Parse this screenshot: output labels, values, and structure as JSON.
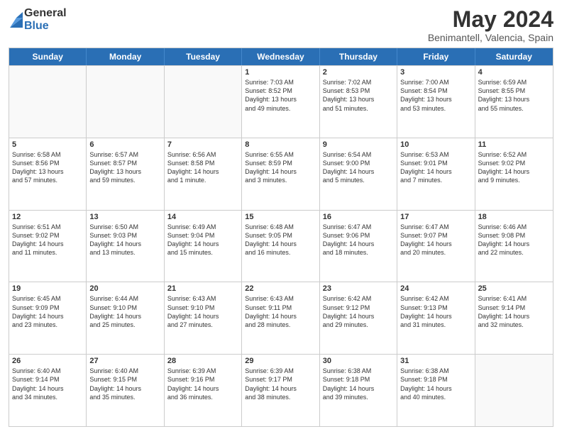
{
  "logo": {
    "general": "General",
    "blue": "Blue"
  },
  "title": "May 2024",
  "subtitle": "Benimantell, Valencia, Spain",
  "header_days": [
    "Sunday",
    "Monday",
    "Tuesday",
    "Wednesday",
    "Thursday",
    "Friday",
    "Saturday"
  ],
  "rows": [
    [
      {
        "day": "",
        "lines": [],
        "empty": true
      },
      {
        "day": "",
        "lines": [],
        "empty": true
      },
      {
        "day": "",
        "lines": [],
        "empty": true
      },
      {
        "day": "1",
        "lines": [
          "Sunrise: 7:03 AM",
          "Sunset: 8:52 PM",
          "Daylight: 13 hours",
          "and 49 minutes."
        ]
      },
      {
        "day": "2",
        "lines": [
          "Sunrise: 7:02 AM",
          "Sunset: 8:53 PM",
          "Daylight: 13 hours",
          "and 51 minutes."
        ]
      },
      {
        "day": "3",
        "lines": [
          "Sunrise: 7:00 AM",
          "Sunset: 8:54 PM",
          "Daylight: 13 hours",
          "and 53 minutes."
        ]
      },
      {
        "day": "4",
        "lines": [
          "Sunrise: 6:59 AM",
          "Sunset: 8:55 PM",
          "Daylight: 13 hours",
          "and 55 minutes."
        ]
      }
    ],
    [
      {
        "day": "5",
        "lines": [
          "Sunrise: 6:58 AM",
          "Sunset: 8:56 PM",
          "Daylight: 13 hours",
          "and 57 minutes."
        ]
      },
      {
        "day": "6",
        "lines": [
          "Sunrise: 6:57 AM",
          "Sunset: 8:57 PM",
          "Daylight: 13 hours",
          "and 59 minutes."
        ]
      },
      {
        "day": "7",
        "lines": [
          "Sunrise: 6:56 AM",
          "Sunset: 8:58 PM",
          "Daylight: 14 hours",
          "and 1 minute."
        ]
      },
      {
        "day": "8",
        "lines": [
          "Sunrise: 6:55 AM",
          "Sunset: 8:59 PM",
          "Daylight: 14 hours",
          "and 3 minutes."
        ]
      },
      {
        "day": "9",
        "lines": [
          "Sunrise: 6:54 AM",
          "Sunset: 9:00 PM",
          "Daylight: 14 hours",
          "and 5 minutes."
        ]
      },
      {
        "day": "10",
        "lines": [
          "Sunrise: 6:53 AM",
          "Sunset: 9:01 PM",
          "Daylight: 14 hours",
          "and 7 minutes."
        ]
      },
      {
        "day": "11",
        "lines": [
          "Sunrise: 6:52 AM",
          "Sunset: 9:02 PM",
          "Daylight: 14 hours",
          "and 9 minutes."
        ]
      }
    ],
    [
      {
        "day": "12",
        "lines": [
          "Sunrise: 6:51 AM",
          "Sunset: 9:02 PM",
          "Daylight: 14 hours",
          "and 11 minutes."
        ]
      },
      {
        "day": "13",
        "lines": [
          "Sunrise: 6:50 AM",
          "Sunset: 9:03 PM",
          "Daylight: 14 hours",
          "and 13 minutes."
        ]
      },
      {
        "day": "14",
        "lines": [
          "Sunrise: 6:49 AM",
          "Sunset: 9:04 PM",
          "Daylight: 14 hours",
          "and 15 minutes."
        ]
      },
      {
        "day": "15",
        "lines": [
          "Sunrise: 6:48 AM",
          "Sunset: 9:05 PM",
          "Daylight: 14 hours",
          "and 16 minutes."
        ]
      },
      {
        "day": "16",
        "lines": [
          "Sunrise: 6:47 AM",
          "Sunset: 9:06 PM",
          "Daylight: 14 hours",
          "and 18 minutes."
        ]
      },
      {
        "day": "17",
        "lines": [
          "Sunrise: 6:47 AM",
          "Sunset: 9:07 PM",
          "Daylight: 14 hours",
          "and 20 minutes."
        ]
      },
      {
        "day": "18",
        "lines": [
          "Sunrise: 6:46 AM",
          "Sunset: 9:08 PM",
          "Daylight: 14 hours",
          "and 22 minutes."
        ]
      }
    ],
    [
      {
        "day": "19",
        "lines": [
          "Sunrise: 6:45 AM",
          "Sunset: 9:09 PM",
          "Daylight: 14 hours",
          "and 23 minutes."
        ]
      },
      {
        "day": "20",
        "lines": [
          "Sunrise: 6:44 AM",
          "Sunset: 9:10 PM",
          "Daylight: 14 hours",
          "and 25 minutes."
        ]
      },
      {
        "day": "21",
        "lines": [
          "Sunrise: 6:43 AM",
          "Sunset: 9:10 PM",
          "Daylight: 14 hours",
          "and 27 minutes."
        ]
      },
      {
        "day": "22",
        "lines": [
          "Sunrise: 6:43 AM",
          "Sunset: 9:11 PM",
          "Daylight: 14 hours",
          "and 28 minutes."
        ]
      },
      {
        "day": "23",
        "lines": [
          "Sunrise: 6:42 AM",
          "Sunset: 9:12 PM",
          "Daylight: 14 hours",
          "and 29 minutes."
        ]
      },
      {
        "day": "24",
        "lines": [
          "Sunrise: 6:42 AM",
          "Sunset: 9:13 PM",
          "Daylight: 14 hours",
          "and 31 minutes."
        ]
      },
      {
        "day": "25",
        "lines": [
          "Sunrise: 6:41 AM",
          "Sunset: 9:14 PM",
          "Daylight: 14 hours",
          "and 32 minutes."
        ]
      }
    ],
    [
      {
        "day": "26",
        "lines": [
          "Sunrise: 6:40 AM",
          "Sunset: 9:14 PM",
          "Daylight: 14 hours",
          "and 34 minutes."
        ]
      },
      {
        "day": "27",
        "lines": [
          "Sunrise: 6:40 AM",
          "Sunset: 9:15 PM",
          "Daylight: 14 hours",
          "and 35 minutes."
        ]
      },
      {
        "day": "28",
        "lines": [
          "Sunrise: 6:39 AM",
          "Sunset: 9:16 PM",
          "Daylight: 14 hours",
          "and 36 minutes."
        ]
      },
      {
        "day": "29",
        "lines": [
          "Sunrise: 6:39 AM",
          "Sunset: 9:17 PM",
          "Daylight: 14 hours",
          "and 38 minutes."
        ]
      },
      {
        "day": "30",
        "lines": [
          "Sunrise: 6:38 AM",
          "Sunset: 9:18 PM",
          "Daylight: 14 hours",
          "and 39 minutes."
        ]
      },
      {
        "day": "31",
        "lines": [
          "Sunrise: 6:38 AM",
          "Sunset: 9:18 PM",
          "Daylight: 14 hours",
          "and 40 minutes."
        ]
      },
      {
        "day": "",
        "lines": [],
        "empty": true
      }
    ]
  ]
}
